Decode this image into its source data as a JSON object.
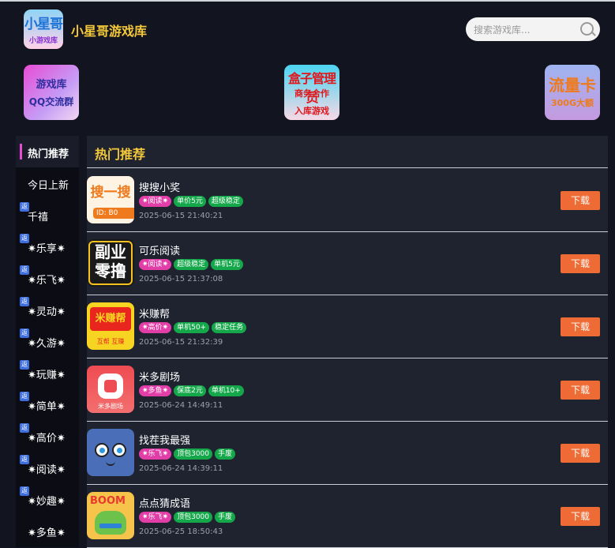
{
  "header": {
    "logo_line1": "小星哥",
    "logo_line2": "小游戏库",
    "site_title": "小星哥游戏库",
    "search_placeholder": "搜索游戏库..."
  },
  "banners": [
    {
      "line1": "游戏库",
      "line2": "QQ交流群"
    },
    {
      "line1": "盒子管理员",
      "line2": "商务合作",
      "line3": "入库游戏"
    },
    {
      "line1": "流量卡",
      "line2": "300G大额"
    }
  ],
  "sidebar": {
    "badge_label": "返",
    "items": [
      {
        "label": "热门推荐",
        "active": true,
        "badge": false
      },
      {
        "label": "今日上新",
        "active": false,
        "badge": false
      },
      {
        "label": "千禧",
        "active": false,
        "badge": true
      },
      {
        "label": "✷乐享✷",
        "active": false,
        "badge": true
      },
      {
        "label": "✷乐飞✷",
        "active": false,
        "badge": true
      },
      {
        "label": "✷灵动✷",
        "active": false,
        "badge": true
      },
      {
        "label": "✷久游✷",
        "active": false,
        "badge": true
      },
      {
        "label": "✷玩赚✷",
        "active": false,
        "badge": true
      },
      {
        "label": "✷简单✷",
        "active": false,
        "badge": true
      },
      {
        "label": "✷高价✷",
        "active": false,
        "badge": true
      },
      {
        "label": "✷阅读✷",
        "active": false,
        "badge": true
      },
      {
        "label": "✷妙趣✷",
        "active": false,
        "badge": true
      },
      {
        "label": "✷多鱼✷",
        "active": false,
        "badge": false
      }
    ]
  },
  "main": {
    "section_title": "热门推荐",
    "download_label": "下载",
    "games": [
      {
        "name": "搜搜小奖",
        "tags": [
          {
            "text": "✷阅读✷",
            "color": "pink"
          },
          {
            "text": "单价5元",
            "color": "green"
          },
          {
            "text": "超级稳定",
            "color": "green"
          }
        ],
        "time": "2025-06-15 21:40:21",
        "thumb_text1": "搜一搜",
        "thumb_text2": "ID: B0",
        "thumb_text3": ""
      },
      {
        "name": "可乐阅读",
        "tags": [
          {
            "text": "✷阅读✷",
            "color": "pink"
          },
          {
            "text": "超级稳定",
            "color": "green"
          },
          {
            "text": "单机5元",
            "color": "green"
          }
        ],
        "time": "2025-06-15 21:37:08",
        "thumb_text1": "副业",
        "thumb_text2": "零撸",
        "thumb_text3": ""
      },
      {
        "name": "米赚帮",
        "tags": [
          {
            "text": "✷高价✷",
            "color": "pink"
          },
          {
            "text": "单机50+",
            "color": "green"
          },
          {
            "text": "稳定任务",
            "color": "green"
          }
        ],
        "time": "2025-06-15 21:32:39",
        "thumb_text1": "米赚帮",
        "thumb_text2": "互帮 互赚",
        "thumb_text3": ""
      },
      {
        "name": "米多剧场",
        "tags": [
          {
            "text": "✷多鱼✷",
            "color": "pink"
          },
          {
            "text": "保底2元",
            "color": "green"
          },
          {
            "text": "单机10+",
            "color": "green"
          }
        ],
        "time": "2025-06-24 14:49:11",
        "thumb_text1": "",
        "thumb_text2": "米多剧场",
        "thumb_text3": ""
      },
      {
        "name": "找茬我最强",
        "tags": [
          {
            "text": "✷乐飞✷",
            "color": "pink"
          },
          {
            "text": "顶包3000",
            "color": "green"
          },
          {
            "text": "手废",
            "color": "green"
          }
        ],
        "time": "2025-06-24 14:39:11",
        "thumb_text1": "",
        "thumb_text2": "",
        "thumb_text3": ""
      },
      {
        "name": "点点猜成语",
        "tags": [
          {
            "text": "✷乐飞✷",
            "color": "pink"
          },
          {
            "text": "顶包3000",
            "color": "green"
          },
          {
            "text": "手废",
            "color": "green"
          }
        ],
        "time": "2025-06-25 18:50:43",
        "thumb_text1": "BOOM",
        "thumb_text2": "",
        "thumb_text3": ""
      }
    ]
  }
}
